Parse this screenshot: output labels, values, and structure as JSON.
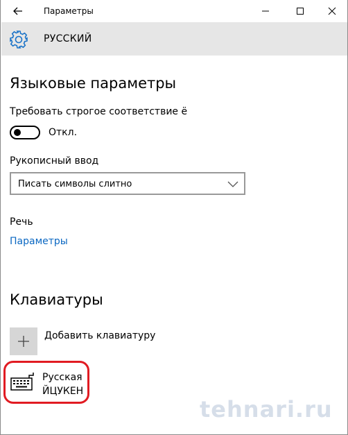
{
  "window": {
    "title": "Параметры"
  },
  "header": {
    "title": "РУССКИЙ",
    "icon": "gear-icon"
  },
  "language_section": {
    "title": "Языковые параметры",
    "strict_match_label": "Требовать строгое соответствие ё",
    "toggle_state_label": "Откл.",
    "toggle_on": false,
    "handwriting_label": "Рукописный ввод",
    "handwriting_value": "Писать символы слитно",
    "speech_label": "Речь",
    "speech_link": "Параметры"
  },
  "keyboards_section": {
    "title": "Клавиатуры",
    "add_label": "Добавить клавиатуру",
    "items": [
      {
        "name": "Русская",
        "layout": "ЙЦУКЕН"
      }
    ]
  },
  "watermark": "tehnari.ru",
  "colors": {
    "header_bg": "#e6e6e6",
    "link": "#0a67c2",
    "highlight": "#e11b22",
    "accent_icon": "#1a73c8"
  }
}
